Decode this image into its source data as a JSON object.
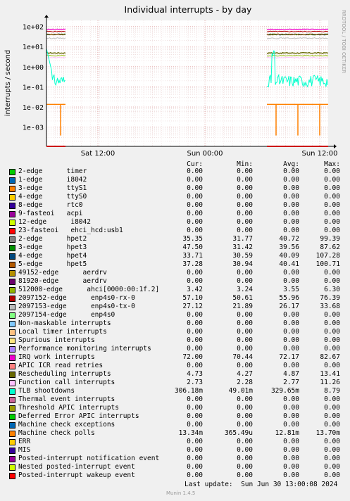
{
  "chart_data": {
    "type": "line",
    "title": "Individual interrupts - by day",
    "ylabel": "interrupts / second",
    "yscale": "log",
    "yticks": [
      "1e-03",
      "1e-02",
      "1e-01",
      "1e+00",
      "1e+01",
      "1e+02"
    ],
    "xticks": [
      "Sat 12:00",
      "Sun 00:00",
      "Sun 12:00"
    ],
    "watermark": "RRDTOOL / TOBI OETIKER",
    "grid": true,
    "data_gap": "Most of the period shows no data; data present only at the very start and from about Sun 06:00 to the end."
  },
  "legend": {
    "headers": [
      "Cur:",
      "Min:",
      "Avg:",
      "Max:"
    ],
    "rows": [
      {
        "name": "2-edge      timer",
        "color": "#00cc00",
        "cur": "0.00",
        "min": "0.00",
        "avg": "0.00",
        "max": "0.00"
      },
      {
        "name": "1-edge      i8042",
        "color": "#0066b3",
        "cur": "0.00",
        "min": "0.00",
        "avg": "0.00",
        "max": "0.00"
      },
      {
        "name": "3-edge      ttyS1",
        "color": "#ff8000",
        "cur": "0.00",
        "min": "0.00",
        "avg": "0.00",
        "max": "0.00"
      },
      {
        "name": "4-edge      ttyS0",
        "color": "#ffcc00",
        "cur": "0.00",
        "min": "0.00",
        "avg": "0.00",
        "max": "0.00"
      },
      {
        "name": "8-edge      rtc0",
        "color": "#330099",
        "cur": "0.00",
        "min": "0.00",
        "avg": "0.00",
        "max": "0.00"
      },
      {
        "name": "9-fasteoi   acpi",
        "color": "#990099",
        "cur": "0.00",
        "min": "0.00",
        "avg": "0.00",
        "max": "0.00"
      },
      {
        "name": "12-edge      i8042",
        "color": "#ccff00",
        "cur": "0.00",
        "min": "0.00",
        "avg": "0.00",
        "max": "0.00"
      },
      {
        "name": "23-fasteoi   ehci_hcd:usb1",
        "color": "#ff0000",
        "cur": "0.00",
        "min": "0.00",
        "avg": "0.00",
        "max": "0.00"
      },
      {
        "name": "2-edge      hpet2",
        "color": "#808080",
        "cur": "35.35",
        "min": "31.77",
        "avg": "40.72",
        "max": "99.39"
      },
      {
        "name": "3-edge      hpet3",
        "color": "#008f00",
        "cur": "47.50",
        "min": "31.42",
        "avg": "39.56",
        "max": "87.62"
      },
      {
        "name": "4-edge      hpet4",
        "color": "#00487d",
        "cur": "33.71",
        "min": "30.59",
        "avg": "40.09",
        "max": "107.28"
      },
      {
        "name": "5-edge      hpet5",
        "color": "#b35a00",
        "cur": "37.28",
        "min": "30.94",
        "avg": "40.41",
        "max": "100.71"
      },
      {
        "name": "49152-edge      aerdrv",
        "color": "#b38f00",
        "cur": "0.00",
        "min": "0.00",
        "avg": "0.00",
        "max": "0.00"
      },
      {
        "name": "81920-edge      aerdrv",
        "color": "#6b006b",
        "cur": "0.00",
        "min": "0.00",
        "avg": "0.00",
        "max": "0.00"
      },
      {
        "name": "512000-edge      ahci[0000:00:1f.2]",
        "color": "#8fb300",
        "cur": "3.42",
        "min": "3.24",
        "avg": "3.55",
        "max": "6.30"
      },
      {
        "name": "2097152-edge      enp4s0-rx-0",
        "color": "#b30000",
        "cur": "57.10",
        "min": "50.61",
        "avg": "55.96",
        "max": "76.39"
      },
      {
        "name": "2097153-edge      enp4s0-tx-0",
        "color": "#bebebe",
        "cur": "27.12",
        "min": "21.89",
        "avg": "26.17",
        "max": "33.68"
      },
      {
        "name": "2097154-edge      enp4s0",
        "color": "#80ff80",
        "cur": "0.00",
        "min": "0.00",
        "avg": "0.00",
        "max": "0.00"
      },
      {
        "name": "Non-maskable interrupts",
        "color": "#80c9ff",
        "cur": "0.00",
        "min": "0.00",
        "avg": "0.00",
        "max": "0.00"
      },
      {
        "name": "Local timer interrupts",
        "color": "#ffc080",
        "cur": "0.00",
        "min": "0.00",
        "avg": "0.00",
        "max": "0.00"
      },
      {
        "name": "Spurious interrupts",
        "color": "#ffe680",
        "cur": "0.00",
        "min": "0.00",
        "avg": "0.00",
        "max": "0.00"
      },
      {
        "name": "Performance monitoring interrupts",
        "color": "#aa80ff",
        "cur": "0.00",
        "min": "0.00",
        "avg": "0.00",
        "max": "0.00"
      },
      {
        "name": "IRQ work interrupts",
        "color": "#ee00cc",
        "cur": "72.00",
        "min": "70.44",
        "avg": "72.17",
        "max": "82.67"
      },
      {
        "name": "APIC ICR read retries",
        "color": "#ff8080",
        "cur": "0.00",
        "min": "0.00",
        "avg": "0.00",
        "max": "0.00"
      },
      {
        "name": "Rescheduling interrupts",
        "color": "#666600",
        "cur": "4.73",
        "min": "4.27",
        "avg": "4.87",
        "max": "13.41"
      },
      {
        "name": "Function call interrupts",
        "color": "#ffbfff",
        "cur": "2.73",
        "min": "2.28",
        "avg": "2.77",
        "max": "11.26"
      },
      {
        "name": "TLB shootdowns",
        "color": "#00ffcc",
        "cur": "306.18m",
        "min": "49.01m",
        "avg": "329.65m",
        "max": "8.79"
      },
      {
        "name": "Thermal event interrupts",
        "color": "#cc6699",
        "cur": "0.00",
        "min": "0.00",
        "avg": "0.00",
        "max": "0.00"
      },
      {
        "name": "Threshold APIC interrupts",
        "color": "#999900",
        "cur": "0.00",
        "min": "0.00",
        "avg": "0.00",
        "max": "0.00"
      },
      {
        "name": "Deferred Error APIC interrupts",
        "color": "#00cc00",
        "cur": "0.00",
        "min": "0.00",
        "avg": "0.00",
        "max": "0.00"
      },
      {
        "name": "Machine check exceptions",
        "color": "#0066b3",
        "cur": "0.00",
        "min": "0.00",
        "avg": "0.00",
        "max": "0.00"
      },
      {
        "name": "Machine check polls",
        "color": "#ff8000",
        "cur": "13.34m",
        "min": "365.49u",
        "avg": "12.81m",
        "max": "13.70m"
      },
      {
        "name": "ERR",
        "color": "#ffcc00",
        "cur": "0.00",
        "min": "0.00",
        "avg": "0.00",
        "max": "0.00"
      },
      {
        "name": "MIS",
        "color": "#330099",
        "cur": "0.00",
        "min": "0.00",
        "avg": "0.00",
        "max": "0.00"
      },
      {
        "name": "Posted-interrupt notification event",
        "color": "#990099",
        "cur": "0.00",
        "min": "0.00",
        "avg": "0.00",
        "max": "0.00"
      },
      {
        "name": "Nested posted-interrupt event",
        "color": "#ccff00",
        "cur": "0.00",
        "min": "0.00",
        "avg": "0.00",
        "max": "0.00"
      },
      {
        "name": "Posted-interrupt wakeup event",
        "color": "#ff0000",
        "cur": "0.00",
        "min": "0.00",
        "avg": "0.00",
        "max": "0.00"
      }
    ]
  },
  "footer": {
    "last_update": "Last update:  Sun Jun 30 13:00:08 2024",
    "generator": "Munin 1.4.5"
  }
}
